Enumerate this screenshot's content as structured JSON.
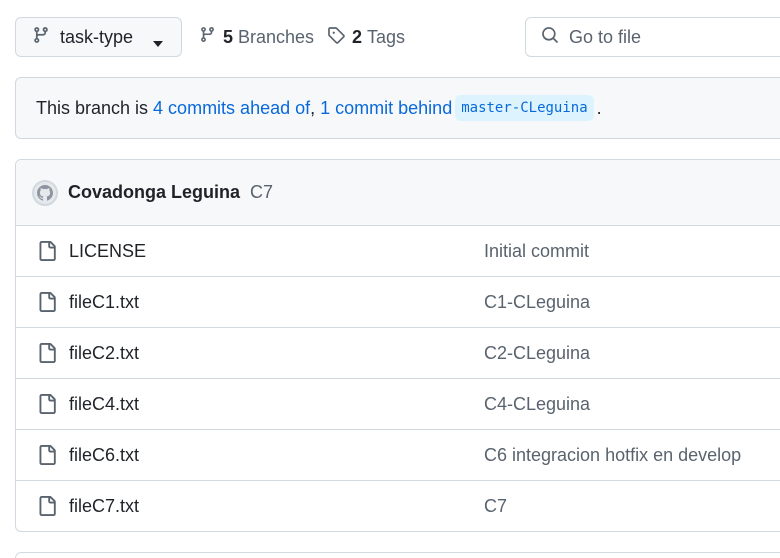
{
  "branch": {
    "name": "task-type"
  },
  "repo_meta": {
    "branches_count": "5",
    "branches_label": "Branches",
    "tags_count": "2",
    "tags_label": "Tags"
  },
  "search": {
    "placeholder": "Go to file"
  },
  "branch_status": {
    "prefix": "This branch is ",
    "ahead": "4 commits ahead of",
    "sep": ", ",
    "behind": "1 commit behind",
    "base": "master-CLeguina",
    "suffix": "."
  },
  "latest_commit": {
    "author": "Covadonga Leguina",
    "message": "C7"
  },
  "files": [
    {
      "name": "LICENSE",
      "message": "Initial commit"
    },
    {
      "name": "fileC1.txt",
      "message": "C1-CLeguina"
    },
    {
      "name": "fileC2.txt",
      "message": "C2-CLeguina"
    },
    {
      "name": "fileC4.txt",
      "message": "C4-CLeguina"
    },
    {
      "name": "fileC6.txt",
      "message": "C6 integracion hotfix en develop"
    },
    {
      "name": "fileC7.txt",
      "message": "C7"
    }
  ],
  "icons": {
    "branch": "git-branch-icon",
    "caret": "triangle-down-icon",
    "tag": "tag-icon",
    "search": "search-icon",
    "avatar": "github-mark-icon",
    "file": "file-icon"
  },
  "colors": {
    "link": "#0969da",
    "muted": "#59636e",
    "border": "#d1d9e0",
    "subtle_bg": "#f6f8fa"
  }
}
